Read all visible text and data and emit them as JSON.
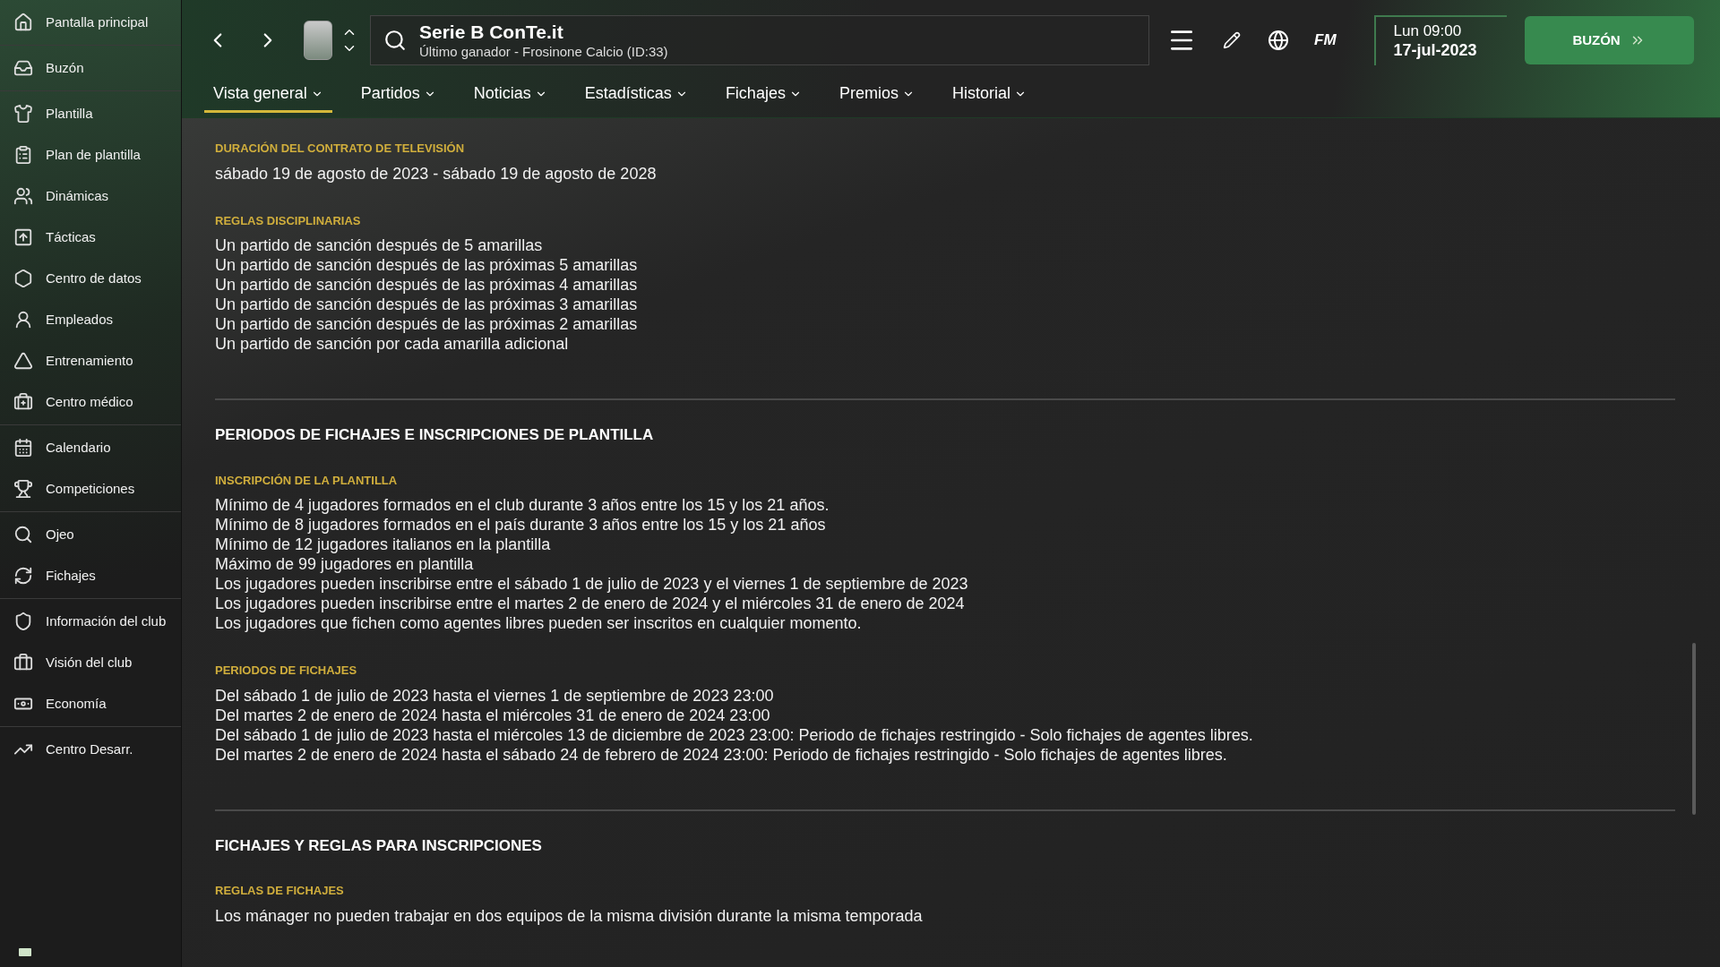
{
  "sidebar": {
    "groups": [
      [
        {
          "label": "Pantalla principal"
        }
      ],
      [
        {
          "label": "Buzón"
        }
      ],
      [
        {
          "label": "Plantilla"
        },
        {
          "label": "Plan de plantilla"
        },
        {
          "label": "Dinámicas"
        },
        {
          "label": "Tácticas"
        },
        {
          "label": "Centro de datos"
        },
        {
          "label": "Empleados"
        },
        {
          "label": "Entrenamiento"
        },
        {
          "label": "Centro médico"
        }
      ],
      [
        {
          "label": "Calendario"
        },
        {
          "label": "Competiciones"
        }
      ],
      [
        {
          "label": "Ojeo"
        },
        {
          "label": "Fichajes"
        }
      ],
      [
        {
          "label": "Información del club"
        },
        {
          "label": "Visión del club"
        },
        {
          "label": "Economía"
        }
      ],
      [
        {
          "label": "Centro Desarr."
        }
      ]
    ]
  },
  "header": {
    "title": "Serie B ConTe.it",
    "subtitle": "Último ganador - Frosinone Calcio (ID:33)",
    "fm_logo": "FM",
    "day_time": "Lun 09:00",
    "date": "17-jul-2023",
    "mail_button": "BUZÓN"
  },
  "tabs": [
    {
      "label": "Vista general",
      "selected": true
    },
    {
      "label": "Partidos",
      "selected": false
    },
    {
      "label": "Noticias",
      "selected": false
    },
    {
      "label": "Estadísticas",
      "selected": false
    },
    {
      "label": "Fichajes",
      "selected": false
    },
    {
      "label": "Premios",
      "selected": false
    },
    {
      "label": "Historial",
      "selected": false
    }
  ],
  "sections": [
    {
      "subsections": [
        {
          "heading": "DURACIÓN DEL CONTRATO DE TELEVISIÓN",
          "lines": [
            "sábado 19 de agosto de 2023 - sábado 19 de agosto de 2028"
          ]
        },
        {
          "heading": "REGLAS DISCIPLINARIAS",
          "lines": [
            "Un partido de sanción después de 5 amarillas",
            "Un partido de sanción después de las próximas 5 amarillas",
            "Un partido de sanción después de las próximas 4 amarillas",
            "Un partido de sanción después de las próximas 3 amarillas",
            "Un partido de sanción después de las próximas 2 amarillas",
            "Un partido de sanción por cada amarilla adicional"
          ]
        }
      ]
    },
    {
      "title": "PERIODOS DE FICHAJES E INSCRIPCIONES DE PLANTILLA",
      "subsections": [
        {
          "heading": "INSCRIPCIÓN DE LA PLANTILLA",
          "lines": [
            "Mínimo de 4 jugadores formados en el club durante 3 años entre los 15 y los 21 años.",
            "Mínimo de 8 jugadores formados en el país durante 3 años entre los 15 y los 21 años",
            "Mínimo de 12 jugadores italianos en la plantilla",
            "Máximo de 99 jugadores en plantilla",
            "Los jugadores pueden inscribirse entre el sábado 1 de julio de 2023 y el viernes 1 de septiembre de 2023",
            "Los jugadores pueden inscribirse entre el martes 2 de enero de 2024 y el miércoles 31 de enero de 2024",
            "Los jugadores que fichen como agentes libres pueden ser inscritos en cualquier momento."
          ]
        },
        {
          "heading": "PERIODOS DE FICHAJES",
          "lines": [
            "Del sábado 1 de julio de 2023 hasta el viernes 1 de septiembre de 2023 23:00",
            "Del martes 2 de enero de 2024 hasta el miércoles 31 de enero de 2024 23:00",
            "Del sábado 1 de julio de 2023 hasta el miércoles 13 de diciembre de 2023 23:00: Periodo de fichajes restringido - Solo fichajes de agentes libres.",
            "Del martes 2 de enero de 2024 hasta el sábado 24 de febrero de 2024 23:00: Periodo de fichajes restringido - Solo fichajes de agentes libres."
          ]
        }
      ]
    },
    {
      "title": "FICHAJES Y REGLAS PARA INSCRIPCIONES",
      "subsections": [
        {
          "heading": "REGLAS DE FICHAJES",
          "lines": [
            "Los mánager no pueden trabajar en dos equipos de la misma división durante la misma temporada"
          ]
        }
      ]
    }
  ]
}
